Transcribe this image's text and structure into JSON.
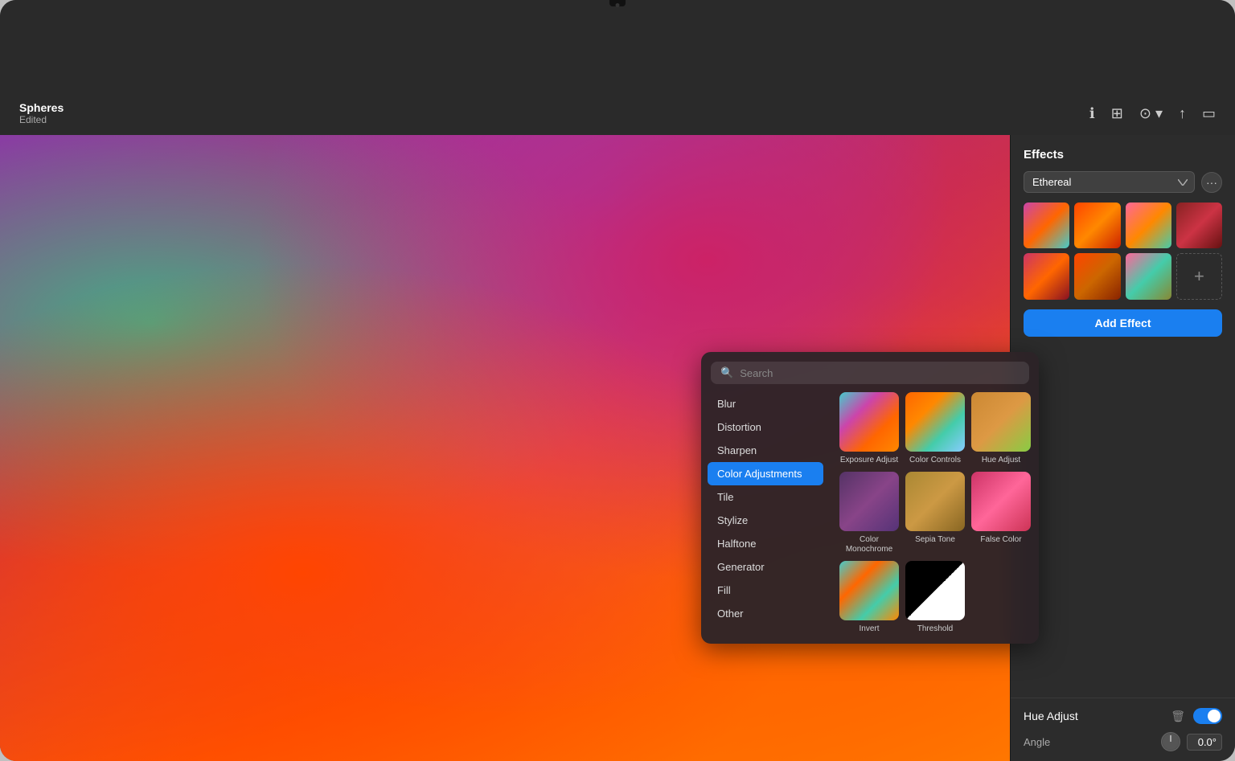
{
  "app": {
    "title": "Spheres",
    "subtitle": "Edited"
  },
  "toolbar": {
    "icons": [
      "ℹ",
      "⊞",
      "⊙",
      "↑",
      "▭"
    ]
  },
  "effects": {
    "panel_title": "Effects",
    "dropdown_value": "Ethereal",
    "add_button": "Add Effect",
    "dropdown_options": [
      "Ethereal"
    ]
  },
  "hue_adjust": {
    "title": "Hue Adjust",
    "angle_label": "Angle",
    "angle_value": "0.0°"
  },
  "popup": {
    "search_placeholder": "Search",
    "categories": [
      {
        "label": "Blur",
        "active": false
      },
      {
        "label": "Distortion",
        "active": false
      },
      {
        "label": "Sharpen",
        "active": false
      },
      {
        "label": "Color Adjustments",
        "active": true
      },
      {
        "label": "Tile",
        "active": false
      },
      {
        "label": "Stylize",
        "active": false
      },
      {
        "label": "Halftone",
        "active": false
      },
      {
        "label": "Generator",
        "active": false
      },
      {
        "label": "Fill",
        "active": false
      },
      {
        "label": "Other",
        "active": false
      }
    ],
    "effects": [
      {
        "label": "Exposure Adjust",
        "class": "et-exposure"
      },
      {
        "label": "Color Controls",
        "class": "et-color-controls"
      },
      {
        "label": "Hue Adjust",
        "class": "et-hue-adjust"
      },
      {
        "label": "Color Monochrome",
        "class": "et-color-mono"
      },
      {
        "label": "Sepia Tone",
        "class": "et-sepia"
      },
      {
        "label": "False Color",
        "class": "et-false-color"
      },
      {
        "label": "Invert",
        "class": "et-invert"
      },
      {
        "label": "Threshold",
        "class": "et-threshold"
      }
    ]
  }
}
